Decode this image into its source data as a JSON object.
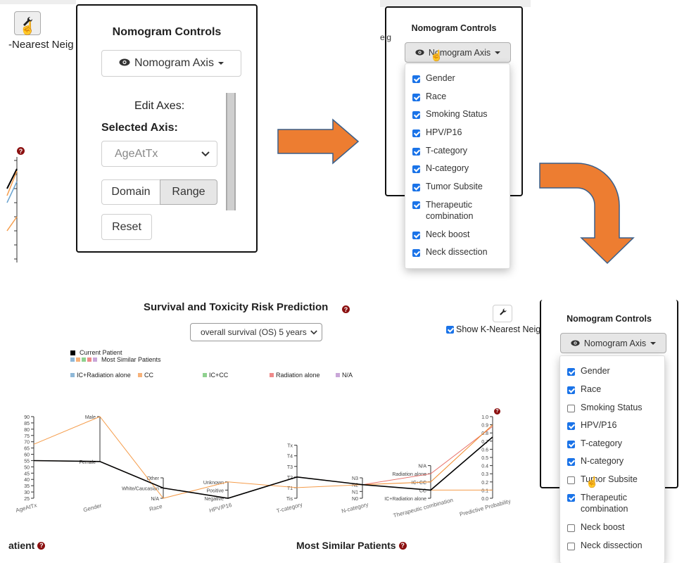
{
  "panel1": {
    "title": "Nomogram Controls",
    "axis_button": "Nomogram Axis",
    "edit_axes": "Edit Axes:",
    "selected_axis": "Selected Axis:",
    "select_value": "AgeAtTx",
    "domain_btn": "Domain",
    "range_btn": "Range",
    "reset_btn": "Reset",
    "knn_fragment": "-Nearest Neig"
  },
  "panel2": {
    "title": "Nomogram Controls",
    "axis_button": "Nomogram Axis",
    "clipped_text": "eig",
    "items": [
      {
        "label": "Gender",
        "checked": true
      },
      {
        "label": "Race",
        "checked": true
      },
      {
        "label": "Smoking Status",
        "checked": true
      },
      {
        "label": "HPV/P16",
        "checked": true
      },
      {
        "label": "T-category",
        "checked": true
      },
      {
        "label": "N-category",
        "checked": true
      },
      {
        "label": "Tumor Subsite",
        "checked": true
      },
      {
        "label": "Therapeutic combination",
        "checked": true
      },
      {
        "label": "Neck boost",
        "checked": true
      },
      {
        "label": "Neck dissection",
        "checked": true
      }
    ]
  },
  "panel3": {
    "title": "Nomogram Controls",
    "axis_button": "Nomogram Axis",
    "items": [
      {
        "label": "Gender",
        "checked": true
      },
      {
        "label": "Race",
        "checked": true
      },
      {
        "label": "Smoking Status",
        "checked": false
      },
      {
        "label": "HPV/P16",
        "checked": true
      },
      {
        "label": "T-category",
        "checked": true
      },
      {
        "label": "N-category",
        "checked": true
      },
      {
        "label": "Tumor Subsite",
        "checked": false
      },
      {
        "label": "Therapeutic combination",
        "checked": true
      },
      {
        "label": "Neck boost",
        "checked": false
      },
      {
        "label": "Neck dissection",
        "checked": false
      }
    ]
  },
  "main": {
    "title": "Survival and Toxicity Risk Prediction",
    "select": "overall survival (OS) 5 years",
    "show_knn": "Show K-Nearest Neig",
    "legend": {
      "current": "Current Patient",
      "similar": "Most Similar Patients",
      "groups": [
        "IC+Radiation alone",
        "CC",
        "IC+CC",
        "Radiation alone",
        "N/A"
      ]
    },
    "bottom_left": "atient",
    "bottom_right": "Most Similar Patients"
  },
  "colors": {
    "blue": "#1a73e8",
    "orange_arrow": "#ed7d31",
    "current": "#000000",
    "similar": "#f59c4a",
    "grp_blue": "#8fb8d8",
    "grp_orange": "#f7b27a",
    "grp_green": "#8fd18f",
    "grp_red": "#ef8a8a",
    "grp_purple": "#c9a6d8",
    "help": "#8b1010"
  },
  "chart_data": {
    "type": "line",
    "axes": [
      {
        "label": "AgeAtTx",
        "ticks": [
          "25",
          "30",
          "35",
          "40",
          "45",
          "50",
          "55",
          "60",
          "65",
          "70",
          "75",
          "80",
          "85",
          "90"
        ]
      },
      {
        "label": "Gender",
        "ticks": [
          "Female",
          "Male"
        ]
      },
      {
        "label": "Race",
        "ticks": [
          "N/A",
          "White/Caucasian",
          "Other"
        ]
      },
      {
        "label": "HPV/P16",
        "ticks": [
          "Negative",
          "Positive",
          "Unknown"
        ]
      },
      {
        "label": "T-category",
        "ticks": [
          "Tis",
          "T1",
          "T2",
          "T3",
          "T4",
          "Tx"
        ]
      },
      {
        "label": "N-category",
        "ticks": [
          "N0",
          "N1",
          "N2",
          "N3"
        ]
      },
      {
        "label": "Therapeutic combination",
        "ticks": [
          "IC+Radiation alone",
          "CC",
          "IC+CC",
          "Radiation alone",
          "N/A"
        ]
      },
      {
        "label": "Predictive Probability",
        "ticks": [
          "0.0",
          "0.1",
          "0.2",
          "0.3",
          "0.4",
          "0.5",
          "0.6",
          "0.7",
          "0.8",
          "0.9",
          "1.0"
        ]
      }
    ],
    "series": [
      {
        "name": "Current Patient",
        "values": [
          55,
          "Female",
          "White/Caucasian",
          "Negative",
          "T2",
          "N2",
          "CC",
          0.75
        ]
      },
      {
        "name": "Most Similar Patients",
        "values": [
          68,
          "Male",
          "N/A",
          "Unknown",
          "T1",
          "N2",
          "CC",
          0.1
        ]
      },
      {
        "name": "Most Similar Patients",
        "values": [
          55,
          "Female",
          "White/Caucasian",
          "Negative",
          "T2",
          "N2",
          "IC+CC",
          0.9
        ]
      },
      {
        "name": "Most Similar Patients",
        "values": [
          55,
          "Female",
          "White/Caucasian",
          "Negative",
          "T2",
          "N2",
          "Radiation alone",
          0.88
        ]
      }
    ]
  }
}
